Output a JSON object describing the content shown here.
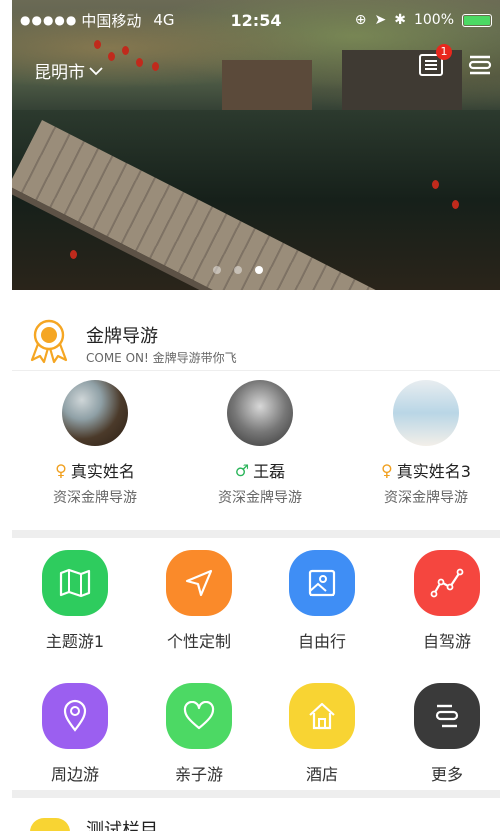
{
  "status_bar": {
    "signal": "●●●●●",
    "carrier": "中国移动",
    "network": "4G",
    "time": "12:54",
    "battery": "100%"
  },
  "header": {
    "city": "昆明市",
    "notification_count": "1"
  },
  "banner": {
    "slide_count": 3,
    "active_slide": 3
  },
  "guides_section": {
    "title": "金牌导游",
    "subtitle": "COME ON! 金牌导游带你飞",
    "guides": [
      {
        "gender": "♀",
        "name": "真实姓名",
        "role": "资深金牌导游"
      },
      {
        "gender": "♂",
        "name": "王磊",
        "role": "资深金牌导游"
      },
      {
        "gender": "♀",
        "name": "真实姓名3",
        "role": "资深金牌导游"
      }
    ]
  },
  "categories": [
    {
      "label": "主题游1",
      "icon": "map-icon",
      "color": "#2ecc5e"
    },
    {
      "label": "个性定制",
      "icon": "navigation-arrow-icon",
      "color": "#fa8a2a"
    },
    {
      "label": "自由行",
      "icon": "picture-icon",
      "color": "#3f8ef5"
    },
    {
      "label": "自驾游",
      "icon": "trend-line-icon",
      "color": "#f5463f"
    },
    {
      "label": "周边游",
      "icon": "location-pin-icon",
      "color": "#9b5ff0"
    },
    {
      "label": "亲子游",
      "icon": "heart-icon",
      "color": "#4cd964"
    },
    {
      "label": "酒店",
      "icon": "home-icon",
      "color": "#f8d433"
    },
    {
      "label": "更多",
      "icon": "more-icon",
      "color": "#3a3a3a"
    }
  ],
  "next_section": {
    "title": "测试栏目"
  }
}
